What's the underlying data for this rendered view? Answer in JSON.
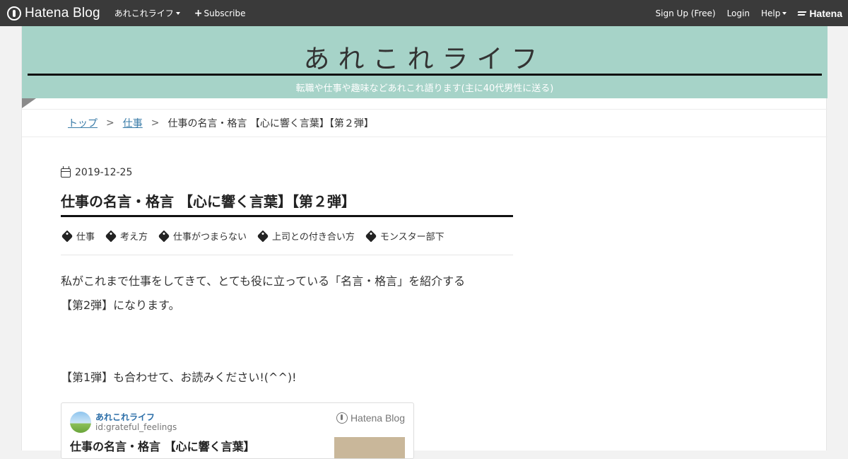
{
  "topbar": {
    "brand": "Hatena Blog",
    "blog_menu": "あれこれライフ",
    "subscribe": "Subscribe",
    "signup": "Sign Up (Free)",
    "login": "Login",
    "help": "Help",
    "hatena": "Hatena"
  },
  "header": {
    "title": "あれこれライフ",
    "description": "転職や仕事や趣味などあれこれ語ります(主に40代男性に送る)",
    "bg_color": "#a6d3c8"
  },
  "breadcrumb": {
    "top": "トップ",
    "category": "仕事",
    "separator": ">",
    "current": "仕事の名言・格言 【心に響く言葉】【第２弾】"
  },
  "entry": {
    "date": "2019-12-25",
    "title": "仕事の名言・格言 【心に響く言葉】【第２弾】",
    "tags": [
      "仕事",
      "考え方",
      "仕事がつまらない",
      "上司との付き合い方",
      "モンスター部下"
    ],
    "para1_line1": "私がこれまで仕事をしてきて、とても役に立っている「名言・格言」を紹介する",
    "para1_line2": "【第2弾】になります。",
    "para2": "【第1弾】も合わせて、お読みください!(^^)!"
  },
  "embed_card": {
    "blog_name": "あれこれライフ",
    "blog_id": "id:grateful_feelings",
    "brand": "Hatena Blog",
    "title": "仕事の名言・格言 【心に響く言葉】"
  }
}
